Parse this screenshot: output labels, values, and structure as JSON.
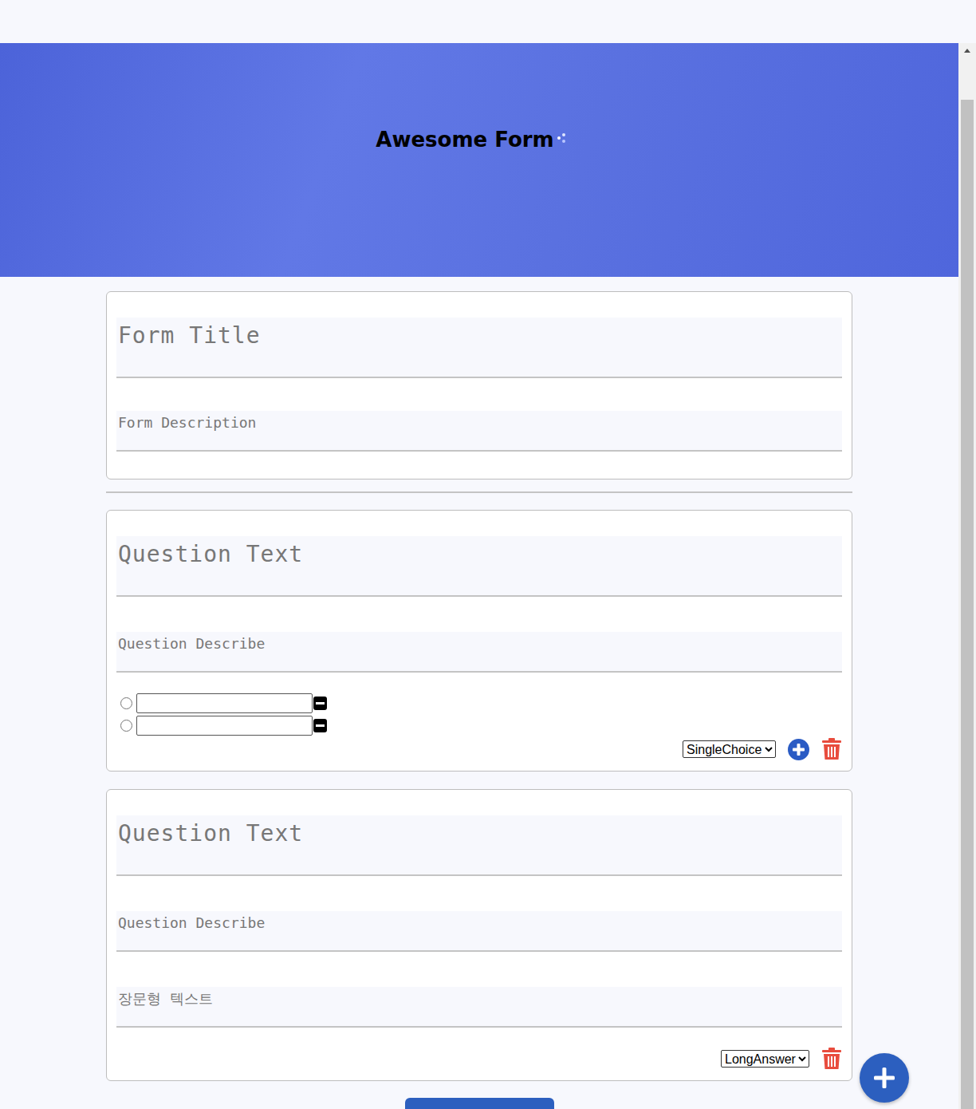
{
  "header": {
    "title": "Awesome Form"
  },
  "form": {
    "title_placeholder": "Form Title",
    "description_placeholder": "Form Description"
  },
  "questions": [
    {
      "kind": "choice",
      "title_placeholder": "Question Text",
      "description_placeholder": "Question Describe",
      "options": [
        {
          "selected": false,
          "value": ""
        },
        {
          "selected": false,
          "value": ""
        }
      ],
      "type": "SingleChoice"
    },
    {
      "kind": "long",
      "title_placeholder": "Question Text",
      "description_placeholder": "Question Describe",
      "answer_placeholder": "장문형 텍스트",
      "type": "LongAnswer"
    }
  ]
}
